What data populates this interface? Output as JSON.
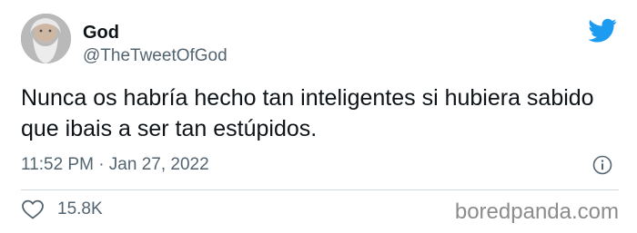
{
  "author": {
    "display_name": "God",
    "handle": "@TheTweetOfGod"
  },
  "tweet": {
    "text": "Nunca os habría hecho tan inteligentes si hubiera sabido que ibais a ser tan estúpidos.",
    "timestamp": "11:52 PM · Jan 27, 2022"
  },
  "engagement": {
    "likes": "15.8K"
  },
  "icons": {
    "brand": "twitter-bird-icon",
    "info": "info-icon",
    "like": "heart-icon"
  },
  "watermark": "boredpanda.com",
  "colors": {
    "text_primary": "#0f1419",
    "text_secondary": "#536471",
    "twitter_blue": "#1d9bf0",
    "divider": "#cfd9de",
    "watermark": "#8c8c8c"
  }
}
